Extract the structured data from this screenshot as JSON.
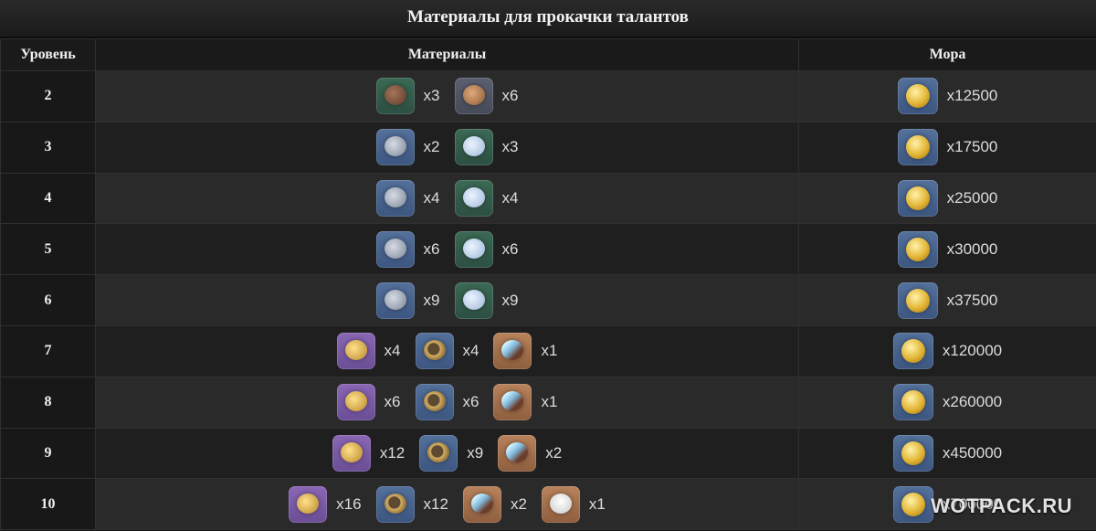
{
  "title": "Материалы для прокачки талантов",
  "headers": {
    "level": "Уровень",
    "materials": "Материалы",
    "mora": "Мора"
  },
  "rows": [
    {
      "level": "2",
      "mora": "x12500",
      "materials": [
        {
          "icon": "brown-crest-icon",
          "bg": "green",
          "fg": "brown",
          "qty": "x3"
        },
        {
          "icon": "bronze-teaching-icon",
          "bg": "grey",
          "fg": "bronze",
          "qty": "x6"
        }
      ]
    },
    {
      "level": "3",
      "mora": "x17500",
      "materials": [
        {
          "icon": "silver-crest-icon",
          "bg": "blue",
          "fg": "silver",
          "qty": "x2"
        },
        {
          "icon": "silver-guide-icon",
          "bg": "green",
          "fg": "ice",
          "qty": "x3"
        }
      ]
    },
    {
      "level": "4",
      "mora": "x25000",
      "materials": [
        {
          "icon": "silver-crest-icon",
          "bg": "blue",
          "fg": "silver",
          "qty": "x4"
        },
        {
          "icon": "silver-guide-icon",
          "bg": "green",
          "fg": "ice",
          "qty": "x4"
        }
      ]
    },
    {
      "level": "5",
      "mora": "x30000",
      "materials": [
        {
          "icon": "silver-crest-icon",
          "bg": "blue",
          "fg": "silver",
          "qty": "x6"
        },
        {
          "icon": "silver-guide-icon",
          "bg": "green",
          "fg": "ice",
          "qty": "x6"
        }
      ]
    },
    {
      "level": "6",
      "mora": "x37500",
      "materials": [
        {
          "icon": "silver-crest-icon",
          "bg": "blue",
          "fg": "silver",
          "qty": "x9"
        },
        {
          "icon": "silver-guide-icon",
          "bg": "green",
          "fg": "ice",
          "qty": "x9"
        }
      ]
    },
    {
      "level": "7",
      "mora": "x120000",
      "materials": [
        {
          "icon": "gold-crest-icon",
          "bg": "purple",
          "fg": "gold",
          "qty": "x4"
        },
        {
          "icon": "gold-philosophy-icon",
          "bg": "blue",
          "fg": "goldring",
          "qty": "x4"
        },
        {
          "icon": "feather-boss-material-icon",
          "bg": "orange",
          "fg": "feather",
          "qty": "x1"
        }
      ]
    },
    {
      "level": "8",
      "mora": "x260000",
      "materials": [
        {
          "icon": "gold-crest-icon",
          "bg": "purple",
          "fg": "gold",
          "qty": "x6"
        },
        {
          "icon": "gold-philosophy-icon",
          "bg": "blue",
          "fg": "goldring",
          "qty": "x6"
        },
        {
          "icon": "feather-boss-material-icon",
          "bg": "orange",
          "fg": "feather",
          "qty": "x1"
        }
      ]
    },
    {
      "level": "9",
      "mora": "x450000",
      "materials": [
        {
          "icon": "gold-crest-icon",
          "bg": "purple",
          "fg": "gold",
          "qty": "x12"
        },
        {
          "icon": "gold-philosophy-icon",
          "bg": "blue",
          "fg": "goldring",
          "qty": "x9"
        },
        {
          "icon": "feather-boss-material-icon",
          "bg": "orange",
          "fg": "feather",
          "qty": "x2"
        }
      ]
    },
    {
      "level": "10",
      "mora": "x700000",
      "materials": [
        {
          "icon": "gold-crest-icon",
          "bg": "purple",
          "fg": "gold",
          "qty": "x16"
        },
        {
          "icon": "gold-philosophy-icon",
          "bg": "blue",
          "fg": "goldring",
          "qty": "x12"
        },
        {
          "icon": "feather-boss-material-icon",
          "bg": "orange",
          "fg": "feather",
          "qty": "x2"
        },
        {
          "icon": "crown-of-insight-icon",
          "bg": "orange",
          "fg": "crown",
          "qty": "x1"
        }
      ]
    }
  ],
  "watermark": "WOTPACK.RU"
}
